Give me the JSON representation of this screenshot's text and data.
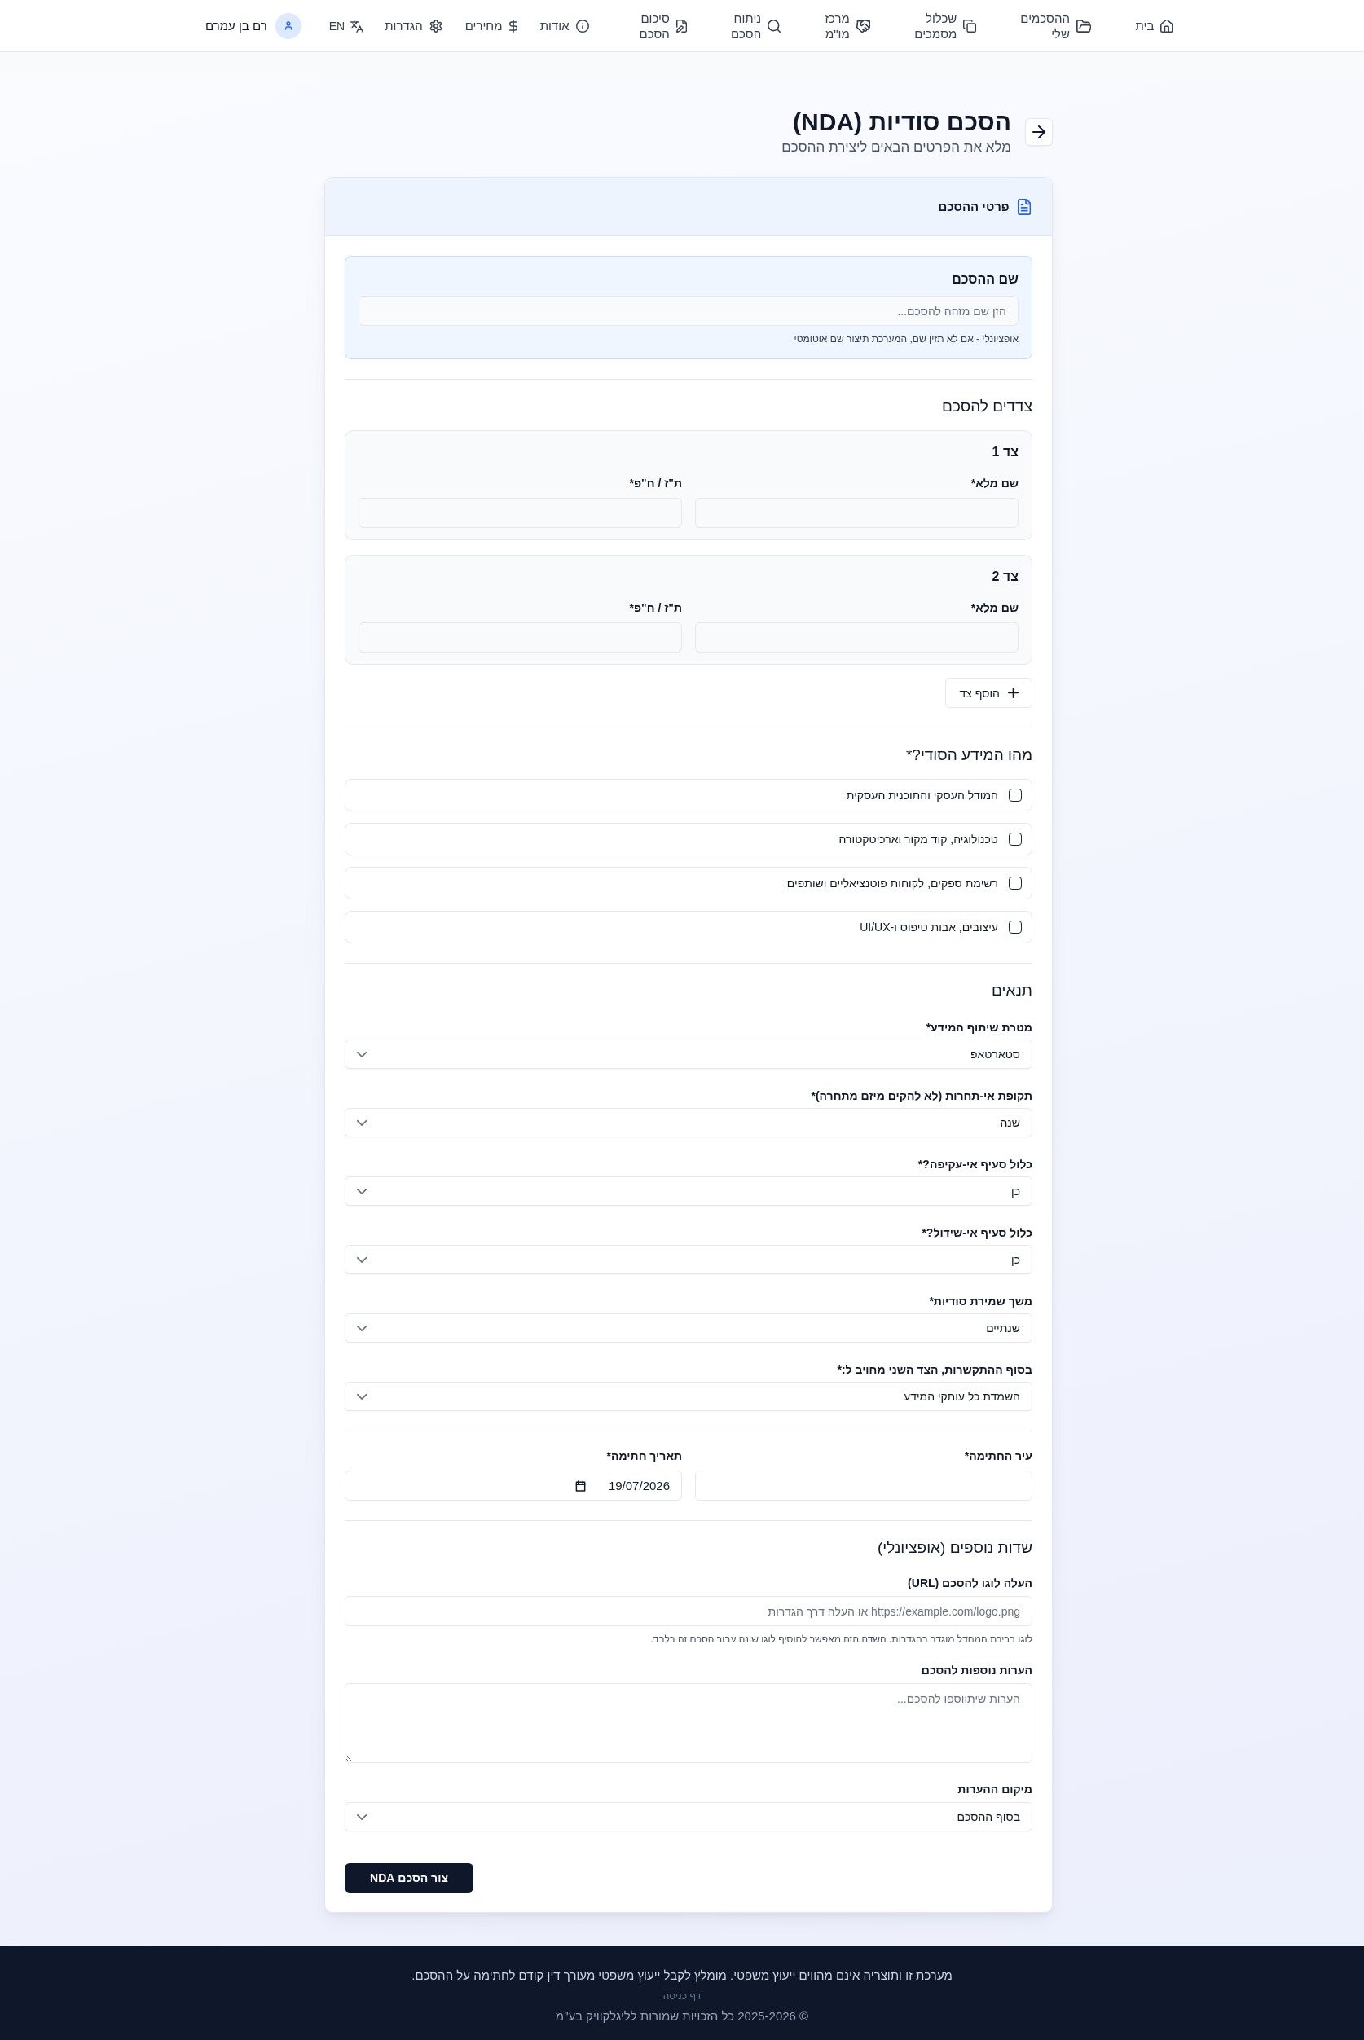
{
  "nav": {
    "links": [
      "בית",
      "ההסכמים שלי",
      "שכלול מסמכים",
      "מרכז מו\"מ",
      "ניתוח הסכם",
      "סיכום הסכם"
    ],
    "secondary_links": [
      "אודות",
      "מחירים",
      "הגדרות"
    ],
    "language": "EN",
    "user_name": "רם בן עמרם"
  },
  "header": {
    "title": "הסכם סודיות (NDA)",
    "subtitle": "מלא את הפרטים הבאים ליצירת ההסכם"
  },
  "form": {
    "title": "פרטי ההסכם",
    "agreement_name": {
      "label": "שם ההסכם",
      "placeholder": "הזן שם מזהה להסכם...",
      "help": "אופציונלי - אם לא תזין שם, המערכת תיצור שם אוטומטי"
    },
    "parties": {
      "title": "צדדים להסכם",
      "items": [
        {
          "title": "צד 1",
          "fields": [
            "שם מלא*",
            "ת\"ז / ח\"פ*"
          ]
        },
        {
          "title": "צד 2",
          "fields": [
            "שם מלא*",
            "ת\"ז / ח\"פ*"
          ]
        }
      ],
      "add_button": "הוסף צד"
    },
    "confidential_info": {
      "title": "מהו המידע הסודי?*",
      "options": [
        {
          "label": "המודל העסקי והתוכנית העסקית",
          "checked": false
        },
        {
          "label": "טכנולוגיה, קוד מקור וארכיטקטורה",
          "checked": false
        },
        {
          "label": "רשימת ספקים, לקוחות פוטנציאליים ושותפים",
          "checked": false
        },
        {
          "label": "עיצובים, אבות טיפוס ו-UI/UX",
          "checked": false
        }
      ]
    },
    "terms": {
      "title": "תנאים",
      "selects": [
        {
          "label": "מטרת שיתוף המידע*",
          "value": "סטארטאפ"
        },
        {
          "label": "תקופת אי-תחרות (לא להקים מיזם מתחרה)*",
          "value": "שנה"
        },
        {
          "label": "כלול סעיף אי-עקיפה?*",
          "value": "כן"
        },
        {
          "label": "כלול סעיף אי-שידול?*",
          "value": "כן"
        },
        {
          "label": "משך שמירת סודיות*",
          "value": "שנתיים"
        },
        {
          "label": "בסוף ההתקשרות, הצד השני מחויב ל:*",
          "value": "השמדת כל עותקי המידע"
        }
      ]
    },
    "signing": [
      {
        "kind": "text",
        "label": "עיר החתימה*"
      },
      {
        "kind": "date",
        "label": "תאריך חתימה*",
        "value": "19/07/2026"
      }
    ],
    "optional": {
      "title": "שדות נוספים (אופציונלי)",
      "logo": {
        "label": "העלה לוגו להסכם (URL)",
        "placeholder": "https://example.com/logo.png או העלה דרך הגדרות",
        "help": "לוגו ברירת המחדל מוגדר בהגדרות. השדה הזה מאפשר להוסיף לוגו שונה עבור הסכם זה בלבד."
      },
      "notes": {
        "label": "הערות נוספות להסכם",
        "placeholder": "הערות שיתווספו להסכם..."
      },
      "notes_position": {
        "label": "מיקום ההערות",
        "value": "בסוף ההסכם"
      }
    },
    "submit_button": "צור הסכם NDA"
  },
  "footer": {
    "disclaimer": "מערכת זו ותוצריה אינם מהווים ייעוץ משפטי. מומלץ לקבל ייעוץ משפטי מעורך דין קודם לחתימה על ההסכם.",
    "link": "דף כניסה",
    "copyright": "© 2025-2026 כל הזכויות שמורות לליגלקוויק בע\"מ"
  }
}
